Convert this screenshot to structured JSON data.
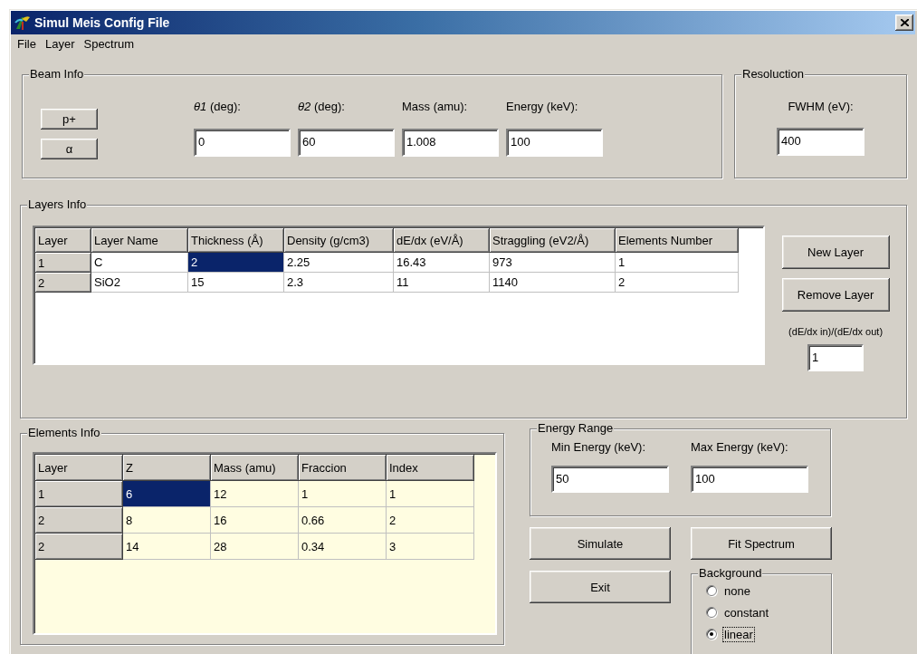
{
  "window": {
    "title": "Simul Meis Config File"
  },
  "menu": [
    {
      "label": "File"
    },
    {
      "label": "Layer"
    },
    {
      "label": "Spectrum"
    }
  ],
  "beam_info": {
    "title": "Beam Info",
    "buttons": [
      {
        "label": "p+"
      },
      {
        "label": "α"
      }
    ],
    "fields": [
      {
        "label": "*θ1* (deg):",
        "value": "0"
      },
      {
        "label": "*θ2* (deg):",
        "value": "60"
      },
      {
        "label": "Mass (amu):",
        "value": "1.008"
      },
      {
        "label": "Energy (keV):",
        "value": "100"
      }
    ]
  },
  "resolution": {
    "title": "Resoluction",
    "fields": [
      {
        "label": "FWHM (eV):",
        "value": "400"
      }
    ]
  },
  "layers_info": {
    "title": "Layers Info",
    "table": {
      "columns": [
        "Layer",
        "Layer Name",
        "Thickness (Å)",
        "Density (g/cm3)",
        "dE/dx (eV/Å)",
        "Straggling (eV2/Å)",
        "Elements Number"
      ],
      "rows": [
        {
          "cells": [
            {
              "text": "1",
              "selected": false
            },
            {
              "text": "C",
              "selected": false
            },
            {
              "text": "2",
              "selected": true
            },
            {
              "text": "2.25",
              "selected": false
            },
            {
              "text": "16.43",
              "selected": false
            },
            {
              "text": "973",
              "selected": false
            },
            {
              "text": "1",
              "selected": false
            }
          ]
        },
        {
          "cells": [
            {
              "text": "2",
              "selected": false
            },
            {
              "text": "SiO2",
              "selected": false
            },
            {
              "text": "15",
              "selected": false
            },
            {
              "text": "2.3",
              "selected": false
            },
            {
              "text": "11",
              "selected": false
            },
            {
              "text": "1140",
              "selected": false
            },
            {
              "text": "2",
              "selected": false
            }
          ]
        }
      ]
    },
    "buttons": [
      {
        "label": "New Layer"
      },
      {
        "label": "Remove Layer"
      }
    ],
    "ratio": {
      "label": "(dE/dx in)/(dE/dx out)",
      "value": "1"
    }
  },
  "elements_info": {
    "title": "Elements Info",
    "table": {
      "columns": [
        "Layer",
        "Z",
        "Mass (amu)",
        "Fraccion",
        "Index"
      ],
      "rows": [
        {
          "cells": [
            {
              "text": "1",
              "selected": false
            },
            {
              "text": "6",
              "selected": true
            },
            {
              "text": "12",
              "selected": false
            },
            {
              "text": "1",
              "selected": false
            },
            {
              "text": "1",
              "selected": false
            }
          ]
        },
        {
          "cells": [
            {
              "text": "2",
              "selected": false
            },
            {
              "text": "8",
              "selected": false
            },
            {
              "text": "16",
              "selected": false
            },
            {
              "text": "0.66",
              "selected": false
            },
            {
              "text": "2",
              "selected": false
            }
          ]
        },
        {
          "cells": [
            {
              "text": "2",
              "selected": false
            },
            {
              "text": "14",
              "selected": false
            },
            {
              "text": "28",
              "selected": false
            },
            {
              "text": "0.34",
              "selected": false
            },
            {
              "text": "3",
              "selected": false
            }
          ]
        }
      ]
    }
  },
  "energy_range": {
    "title": "Energy Range",
    "fields": [
      {
        "label": "Min Energy (keV):",
        "value": "50"
      },
      {
        "label": "Max Energy (keV):",
        "value": "100"
      }
    ]
  },
  "actions": [
    {
      "label": "Simulate"
    },
    {
      "label": "Fit Spectrum"
    },
    {
      "label": "Exit"
    }
  ],
  "background": {
    "title": "Background",
    "options": [
      {
        "label": "none",
        "selected": false,
        "focused": false
      },
      {
        "label": "constant",
        "selected": false,
        "focused": false
      },
      {
        "label": "linear",
        "selected": true,
        "focused": true
      }
    ]
  }
}
